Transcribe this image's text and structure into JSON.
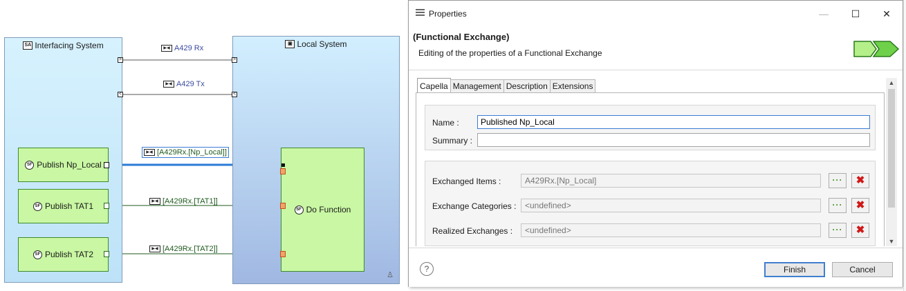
{
  "diagram": {
    "interfacing_system": "Interfacing System",
    "local_system": "Local System",
    "exchanges": {
      "a429_rx": "A429 Rx",
      "a429_tx": "A429 Tx",
      "np_local": "[A429Rx.[Np_Local]]",
      "tat1": "[A429Rx.[TAT1]]",
      "tat2": "[A429Rx.[TAT2]]"
    },
    "functions": {
      "publish_np_local": "Publish Np_Local",
      "publish_tat1": "Publish TAT1",
      "publish_tat2": "Publish TAT2",
      "do_function": "Do Function"
    },
    "icon_labels": {
      "system": "SA",
      "function": "SF"
    },
    "colors": {
      "system_fill_top": "#d6f1fd",
      "system_fill_bottom": "#9fb8e0",
      "function_fill": "#c9f7a3",
      "selected_link": "#2a7ad5",
      "link": "#1e5a1e"
    }
  },
  "dialog": {
    "window_title": "Properties",
    "header_title": "(Functional Exchange)",
    "header_subtitle": "Editing of the properties of a Functional Exchange",
    "tabs": [
      "Capella",
      "Management",
      "Description",
      "Extensions"
    ],
    "active_tab": "Capella",
    "fields": {
      "name_label": "Name :",
      "name_value": "Published Np_Local",
      "summary_label": "Summary :",
      "summary_value": "",
      "exchanged_items_label": "Exchanged Items :",
      "exchanged_items_value": "A429Rx.[Np_Local]",
      "exchange_categories_label": "Exchange Categories :",
      "exchange_categories_value": "<undefined>",
      "realized_exchanges_label": "Realized Exchanges :",
      "realized_exchanges_value": "<undefined>"
    },
    "buttons": {
      "browse": "···",
      "remove": "✖",
      "finish": "Finish",
      "cancel": "Cancel",
      "help": "?"
    },
    "icons": {
      "window": "menu-icon",
      "header": "functional-exchange-arrow-icon"
    }
  }
}
